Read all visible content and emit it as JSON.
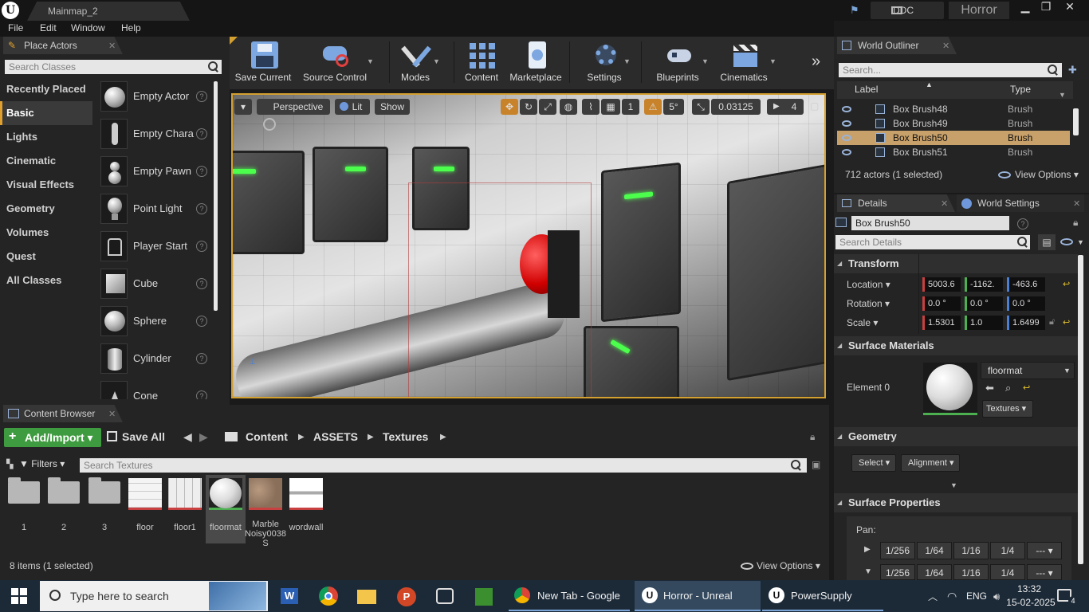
{
  "titlebar": {
    "map_tab": "Mainmap_2",
    "ddc_label": "DDC",
    "project_name": "Horror",
    "minimize": "▁",
    "restore": "❐",
    "close": "✕"
  },
  "menu": [
    "File",
    "Edit",
    "Window",
    "Help"
  ],
  "place_actors": {
    "tab_label": "Place Actors",
    "search_placeholder": "Search Classes",
    "categories": [
      "Recently Placed",
      "Basic",
      "Lights",
      "Cinematic",
      "Visual Effects",
      "Geometry",
      "Volumes",
      "Quest",
      "All Classes"
    ],
    "active_category": "Basic",
    "actors": [
      "Empty Actor",
      "Empty Chara",
      "Empty Pawn",
      "Point Light",
      "Player Start",
      "Cube",
      "Sphere",
      "Cylinder",
      "Cone"
    ],
    "help_glyph": "?"
  },
  "toolbar": {
    "buttons": [
      "Save Current",
      "Source Control",
      "Modes",
      "Content",
      "Marketplace",
      "Settings",
      "Blueprints",
      "Cinematics"
    ],
    "more": "»"
  },
  "viewport": {
    "perspective": "Perspective",
    "lit": "Lit",
    "show": "Show",
    "grid_snap": "1",
    "rot_snap": "5°",
    "scale_snap": "0.03125",
    "cam_speed": "4"
  },
  "world_outliner": {
    "tab_label": "World Outliner",
    "search_placeholder": "Search...",
    "col_label": "Label",
    "col_type": "Type",
    "rows": [
      {
        "label": "Box Brush48",
        "type": "Brush"
      },
      {
        "label": "Box Brush49",
        "type": "Brush"
      },
      {
        "label": "Box Brush50",
        "type": "Brush"
      },
      {
        "label": "Box Brush51",
        "type": "Brush"
      }
    ],
    "selected_index": 2,
    "status": "712 actors (1 selected)",
    "view_options": "View Options"
  },
  "details": {
    "tab_label": "Details",
    "world_settings_tab": "World Settings",
    "object_name": "Box Brush50",
    "search_placeholder": "Search Details",
    "transform": {
      "header": "Transform",
      "location_label": "Location",
      "rotation_label": "Rotation",
      "scale_label": "Scale",
      "location": [
        "5003.6",
        "-1162.",
        "-463.6"
      ],
      "rotation": [
        "0.0 °",
        "0.0 °",
        "0.0 °"
      ],
      "scale": [
        "1.5301",
        "1.0",
        "1.6499"
      ]
    },
    "surface_materials": {
      "header": "Surface Materials",
      "element_label": "Element 0",
      "material": "floormat",
      "textures_btn": "Textures"
    },
    "geometry": {
      "header": "Geometry",
      "select_btn": "Select",
      "alignment_btn": "Alignment"
    },
    "surface_properties": {
      "header": "Surface Properties",
      "pan_label": "Pan:",
      "pan_values": [
        "1/256",
        "1/64",
        "1/16",
        "1/4",
        "---"
      ]
    }
  },
  "content_browser": {
    "tab_label": "Content Browser",
    "add_import": "Add/Import",
    "save_all": "Save All",
    "path": [
      "Content",
      "ASSETS",
      "Textures"
    ],
    "filters": "Filters",
    "search_placeholder": "Search Textures",
    "items": [
      {
        "label": "1",
        "kind": "folder"
      },
      {
        "label": "2",
        "kind": "folder"
      },
      {
        "label": "3",
        "kind": "folder"
      },
      {
        "label": "floor",
        "kind": "texture"
      },
      {
        "label": "floor1",
        "kind": "texture"
      },
      {
        "label": "floormat",
        "kind": "material"
      },
      {
        "label": "Marble Noisy0038 S",
        "kind": "texture"
      },
      {
        "label": "wordwall",
        "kind": "texture"
      }
    ],
    "selected_index": 5,
    "status": "8 items (1 selected)",
    "view_options": "View Options"
  },
  "taskbar": {
    "search_placeholder": "Type here to search",
    "chrome_window": "New Tab - Google ...",
    "unreal_window": "Horror - Unreal Edit...",
    "powersupply_window": "PowerSupply",
    "language": "ENG",
    "time": "13:32",
    "date": "15-02-2025",
    "notifications": "4"
  },
  "colors": {
    "accent_orange": "#d4a030",
    "selection": "#c7a06a",
    "add_import_green": "#3f9b3f"
  }
}
